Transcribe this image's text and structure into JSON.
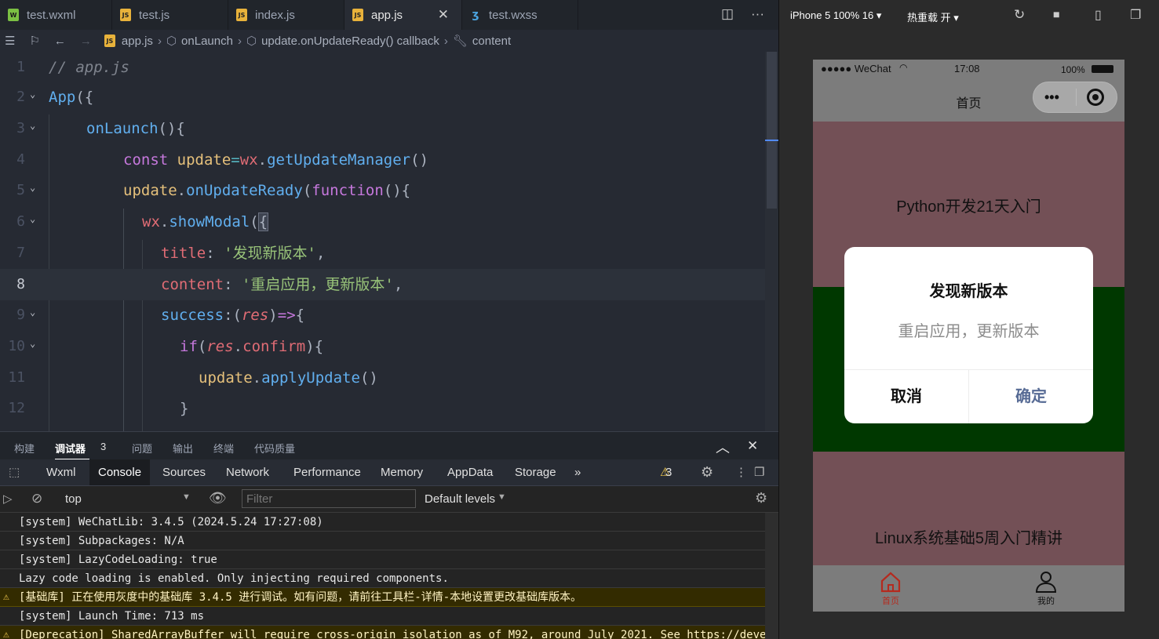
{
  "tabs": [
    {
      "label": "test.wxml",
      "icon": "wxml-file-icon"
    },
    {
      "label": "test.js",
      "icon": "js-file-icon"
    },
    {
      "label": "index.js",
      "icon": "js-file-icon"
    },
    {
      "label": "app.js",
      "icon": "js-file-icon",
      "active": true
    },
    {
      "label": "test.wxss",
      "icon": "css-file-icon"
    }
  ],
  "breadcrumb": [
    "app.js",
    "onLaunch",
    "update.onUpdateReady() callback",
    "content"
  ],
  "editor": {
    "line_numbers": [
      "1",
      "2",
      "3",
      "4",
      "5",
      "6",
      "7",
      "8",
      "9",
      "10",
      "11",
      "12"
    ],
    "current_line": "8",
    "code": {
      "l1": "// app.js",
      "l2_a": "App",
      "l2_b": "({",
      "l3_a": "onLaunch",
      "l3_b": "(){",
      "l4_a": "const",
      "l4_b": "update",
      "l4_c": "=",
      "l4_d": "wx",
      "l4_e": ".",
      "l4_f": "getUpdateManager",
      "l4_g": "()",
      "l5_a": "update",
      "l5_b": ".",
      "l5_c": "onUpdateReady",
      "l5_d": "(",
      "l5_e": "function",
      "l5_f": "(){",
      "l6_a": "wx",
      "l6_b": ".",
      "l6_c": "showModal",
      "l6_d": "(",
      "l6_e": "{",
      "l7_a": "title",
      "l7_b": ": ",
      "l7_c": "'发现新版本'",
      "l7_d": ",",
      "l8_a": "content",
      "l8_b": ": ",
      "l8_c": "'重启应用，更新版本'",
      "l8_d": ",",
      "l9_a": "success",
      "l9_b": ":(",
      "l9_c": "res",
      "l9_d": ")",
      "l9_e": "=>",
      "l9_f": "{",
      "l10_a": "if",
      "l10_b": "(",
      "l10_c": "res",
      "l10_d": ".",
      "l10_e": "confirm",
      "l10_f": "){",
      "l11_a": "update",
      "l11_b": ".",
      "l11_c": "applyUpdate",
      "l11_d": "()",
      "l12": "}"
    }
  },
  "devtools": {
    "top_tabs": [
      "构建",
      "调试器",
      "问题",
      "输出",
      "终端",
      "代码质量"
    ],
    "debugger_badge": "3",
    "panel_tabs": [
      "Wxml",
      "Console",
      "Sources",
      "Network",
      "Performance",
      "Memory",
      "AppData",
      "Storage"
    ],
    "more": "»",
    "warning_count": "3",
    "context": "top",
    "filter_placeholder": "Filter",
    "levels": "Default levels"
  },
  "console_lines": [
    {
      "text": "[system] WeChatLib: 3.4.5 (2024.5.24 17:27:08)",
      "warn": false
    },
    {
      "text": "[system] Subpackages: N/A",
      "warn": false
    },
    {
      "text": "[system] LazyCodeLoading: true",
      "warn": false
    },
    {
      "text": "Lazy code loading is enabled. Only injecting required components.",
      "warn": false
    },
    {
      "text": "[基础库] 正在使用灰度中的基础库 3.4.5 进行调试。如有问题，请前往工具栏-详情-本地设置更改基础库版本。",
      "warn": true
    },
    {
      "text": "[system] Launch Time: 713 ms",
      "warn": false
    },
    {
      "text": "[Deprecation] SharedArrayBuffer will require cross-origin isolation as of M92, around July 2021. See https://deve",
      "warn": true
    }
  ],
  "simulator": {
    "device": "iPhone 5 100% 16",
    "hot_reload": "热重载 开",
    "status": {
      "carrier": "●●●●● WeChat",
      "time": "17:08",
      "battery": "100%"
    },
    "nav_title": "首页",
    "block1_text": "Python开发21天入门",
    "block3_text": "Linux系统基础5周入门精讲",
    "modal": {
      "title": "发现新版本",
      "content": "重启应用，更新版本",
      "cancel": "取消",
      "confirm": "确定"
    },
    "tabbar": [
      {
        "label": "首页"
      },
      {
        "label": "我的"
      }
    ]
  },
  "colors": {
    "editor_bg": "#262a33",
    "block_brown": "#735056",
    "block_green": "#003800",
    "confirm_blue": "#576b95",
    "tab_active_red": "#b52a1e"
  }
}
